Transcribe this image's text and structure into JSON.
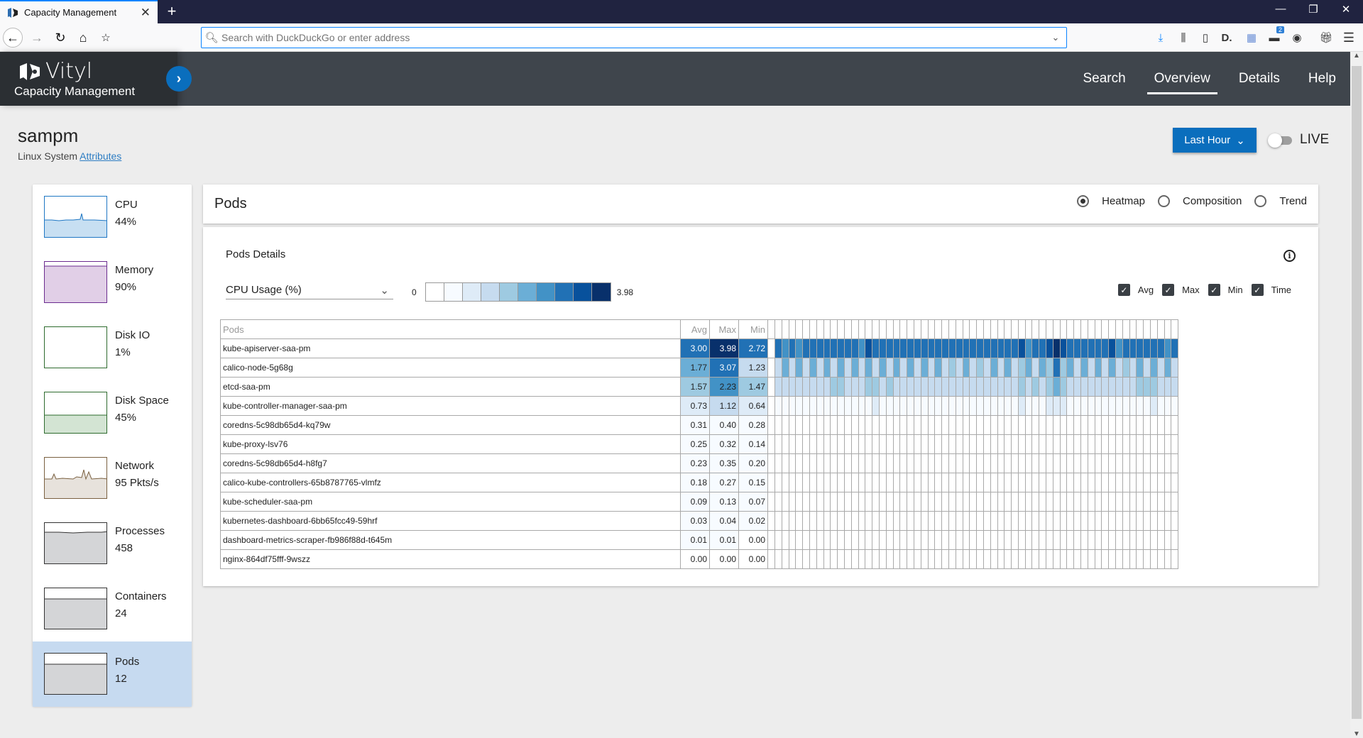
{
  "browser": {
    "tab_title": "Capacity Management",
    "url_placeholder": "Search with DuckDuckGo or enter address",
    "notification_badge": "2"
  },
  "app": {
    "brand_name": "Vityl",
    "brand_subtitle": "Capacity Management",
    "nav": [
      {
        "label": "Search",
        "active": false
      },
      {
        "label": "Overview",
        "active": true
      },
      {
        "label": "Details",
        "active": false
      },
      {
        "label": "Help",
        "active": false
      }
    ]
  },
  "page": {
    "title": "sampm",
    "system_type": "Linux System",
    "attributes_link": "Attributes",
    "time_range": "Last Hour",
    "live_label": "LIVE",
    "live_on": false
  },
  "sidebar": {
    "items": [
      {
        "name": "CPU",
        "value": "44%",
        "color": "#1f77c4",
        "fill": "#c7dff2",
        "active": false
      },
      {
        "name": "Memory",
        "value": "90%",
        "color": "#6b2b8f",
        "fill": "#e1cfe7",
        "active": false
      },
      {
        "name": "Disk IO",
        "value": "1%",
        "color": "#2e6b2e",
        "fill": "#d3e4d3",
        "active": false
      },
      {
        "name": "Disk Space",
        "value": "45%",
        "color": "#2e6b2e",
        "fill": "#d3e4d3",
        "active": false
      },
      {
        "name": "Network",
        "value": "95 Pkts/s",
        "color": "#7a6040",
        "fill": "#e7e2dc",
        "active": false
      },
      {
        "name": "Processes",
        "value": "458",
        "color": "#333333",
        "fill": "#d4d5d7",
        "active": false
      },
      {
        "name": "Containers",
        "value": "24",
        "color": "#333333",
        "fill": "#d4d5d7",
        "active": false
      },
      {
        "name": "Pods",
        "value": "12",
        "color": "#333333",
        "fill": "#d4d5d7",
        "active": true
      }
    ]
  },
  "panel": {
    "title": "Pods",
    "views": [
      {
        "label": "Heatmap",
        "selected": true
      },
      {
        "label": "Composition",
        "selected": false
      },
      {
        "label": "Trend",
        "selected": false
      }
    ],
    "section_title": "Pods Details",
    "metric": "CPU Usage (%)",
    "legend": {
      "min": "0",
      "max": "3.98",
      "colors": [
        "#ffffff",
        "#f7fbff",
        "#deebf7",
        "#c6dbef",
        "#9ecae1",
        "#6baed6",
        "#4292c6",
        "#2171b5",
        "#08519c",
        "#08306b"
      ]
    },
    "columns_toggle": [
      {
        "label": "Avg",
        "checked": true
      },
      {
        "label": "Max",
        "checked": true
      },
      {
        "label": "Min",
        "checked": true
      },
      {
        "label": "Time",
        "checked": true
      }
    ]
  },
  "chart_data": {
    "type": "heatmap",
    "title": "Pods Details",
    "metric": "CPU Usage (%)",
    "scale_range": [
      0,
      3.98
    ],
    "columns": [
      "Pods",
      "Avg",
      "Max",
      "Min"
    ],
    "time_buckets": 58,
    "rows": [
      {
        "pod": "kube-apiserver-saa-pm",
        "avg": "3.00",
        "max": "3.98",
        "min": "2.72",
        "time_levels": [
          7,
          6,
          7,
          6,
          7,
          7,
          7,
          7,
          7,
          7,
          7,
          7,
          6,
          8,
          7,
          7,
          7,
          7,
          7,
          7,
          7,
          7,
          7,
          7,
          7,
          7,
          7,
          7,
          7,
          7,
          7,
          7,
          7,
          7,
          7,
          8,
          6,
          7,
          7,
          8,
          9,
          8,
          7,
          7,
          7,
          7,
          7,
          7,
          8,
          6,
          7,
          7,
          7,
          7,
          7,
          7,
          6,
          7
        ]
      },
      {
        "pod": "calico-node-5g68g",
        "avg": "1.77",
        "max": "3.07",
        "min": "1.23",
        "time_levels": [
          3,
          5,
          3,
          5,
          3,
          5,
          3,
          5,
          3,
          5,
          3,
          5,
          3,
          5,
          3,
          5,
          3,
          5,
          3,
          5,
          3,
          5,
          3,
          5,
          3,
          4,
          3,
          5,
          3,
          4,
          3,
          5,
          3,
          5,
          3,
          4,
          5,
          3,
          5,
          4,
          7,
          4,
          5,
          3,
          5,
          3,
          5,
          3,
          5,
          3,
          4,
          3,
          5,
          3,
          5,
          3,
          5,
          3
        ]
      },
      {
        "pod": "etcd-saa-pm",
        "avg": "1.57",
        "max": "2.23",
        "min": "1.47",
        "time_levels": [
          3,
          3,
          3,
          3,
          3,
          3,
          3,
          3,
          4,
          4,
          3,
          3,
          3,
          4,
          4,
          3,
          4,
          3,
          3,
          3,
          3,
          3,
          3,
          3,
          3,
          3,
          3,
          3,
          3,
          3,
          3,
          3,
          3,
          3,
          3,
          4,
          3,
          4,
          3,
          4,
          5,
          4,
          3,
          3,
          3,
          3,
          3,
          3,
          3,
          3,
          3,
          3,
          4,
          4,
          4,
          3,
          3,
          3
        ]
      },
      {
        "pod": "kube-controller-manager-saa-pm",
        "avg": "0.73",
        "max": "1.12",
        "min": "0.64",
        "time_levels": [
          1,
          1,
          1,
          1,
          1,
          1,
          1,
          1,
          1,
          1,
          1,
          1,
          1,
          1,
          2,
          1,
          1,
          1,
          1,
          1,
          1,
          1,
          1,
          1,
          1,
          1,
          1,
          1,
          1,
          1,
          1,
          1,
          1,
          1,
          1,
          2,
          1,
          1,
          1,
          2,
          2,
          2,
          1,
          1,
          1,
          1,
          1,
          1,
          1,
          1,
          1,
          1,
          1,
          1,
          2,
          1,
          1,
          1
        ]
      },
      {
        "pod": "coredns-5c98db65d4-kq79w",
        "avg": "0.31",
        "max": "0.40",
        "min": "0.28",
        "time_levels": []
      },
      {
        "pod": "kube-proxy-lsv76",
        "avg": "0.25",
        "max": "0.32",
        "min": "0.14",
        "time_levels": []
      },
      {
        "pod": "coredns-5c98db65d4-h8fg7",
        "avg": "0.23",
        "max": "0.35",
        "min": "0.20",
        "time_levels": []
      },
      {
        "pod": "calico-kube-controllers-65b8787765-vlmfz",
        "avg": "0.18",
        "max": "0.27",
        "min": "0.15",
        "time_levels": []
      },
      {
        "pod": "kube-scheduler-saa-pm",
        "avg": "0.09",
        "max": "0.13",
        "min": "0.07",
        "time_levels": []
      },
      {
        "pod": "kubernetes-dashboard-6bb65fcc49-59hrf",
        "avg": "0.03",
        "max": "0.04",
        "min": "0.02",
        "time_levels": []
      },
      {
        "pod": "dashboard-metrics-scraper-fb986f88d-t645m",
        "avg": "0.01",
        "max": "0.01",
        "min": "0.00",
        "time_levels": []
      },
      {
        "pod": "nginx-864df75fff-9wszz",
        "avg": "0.00",
        "max": "0.00",
        "min": "0.00",
        "time_levels": []
      }
    ]
  }
}
